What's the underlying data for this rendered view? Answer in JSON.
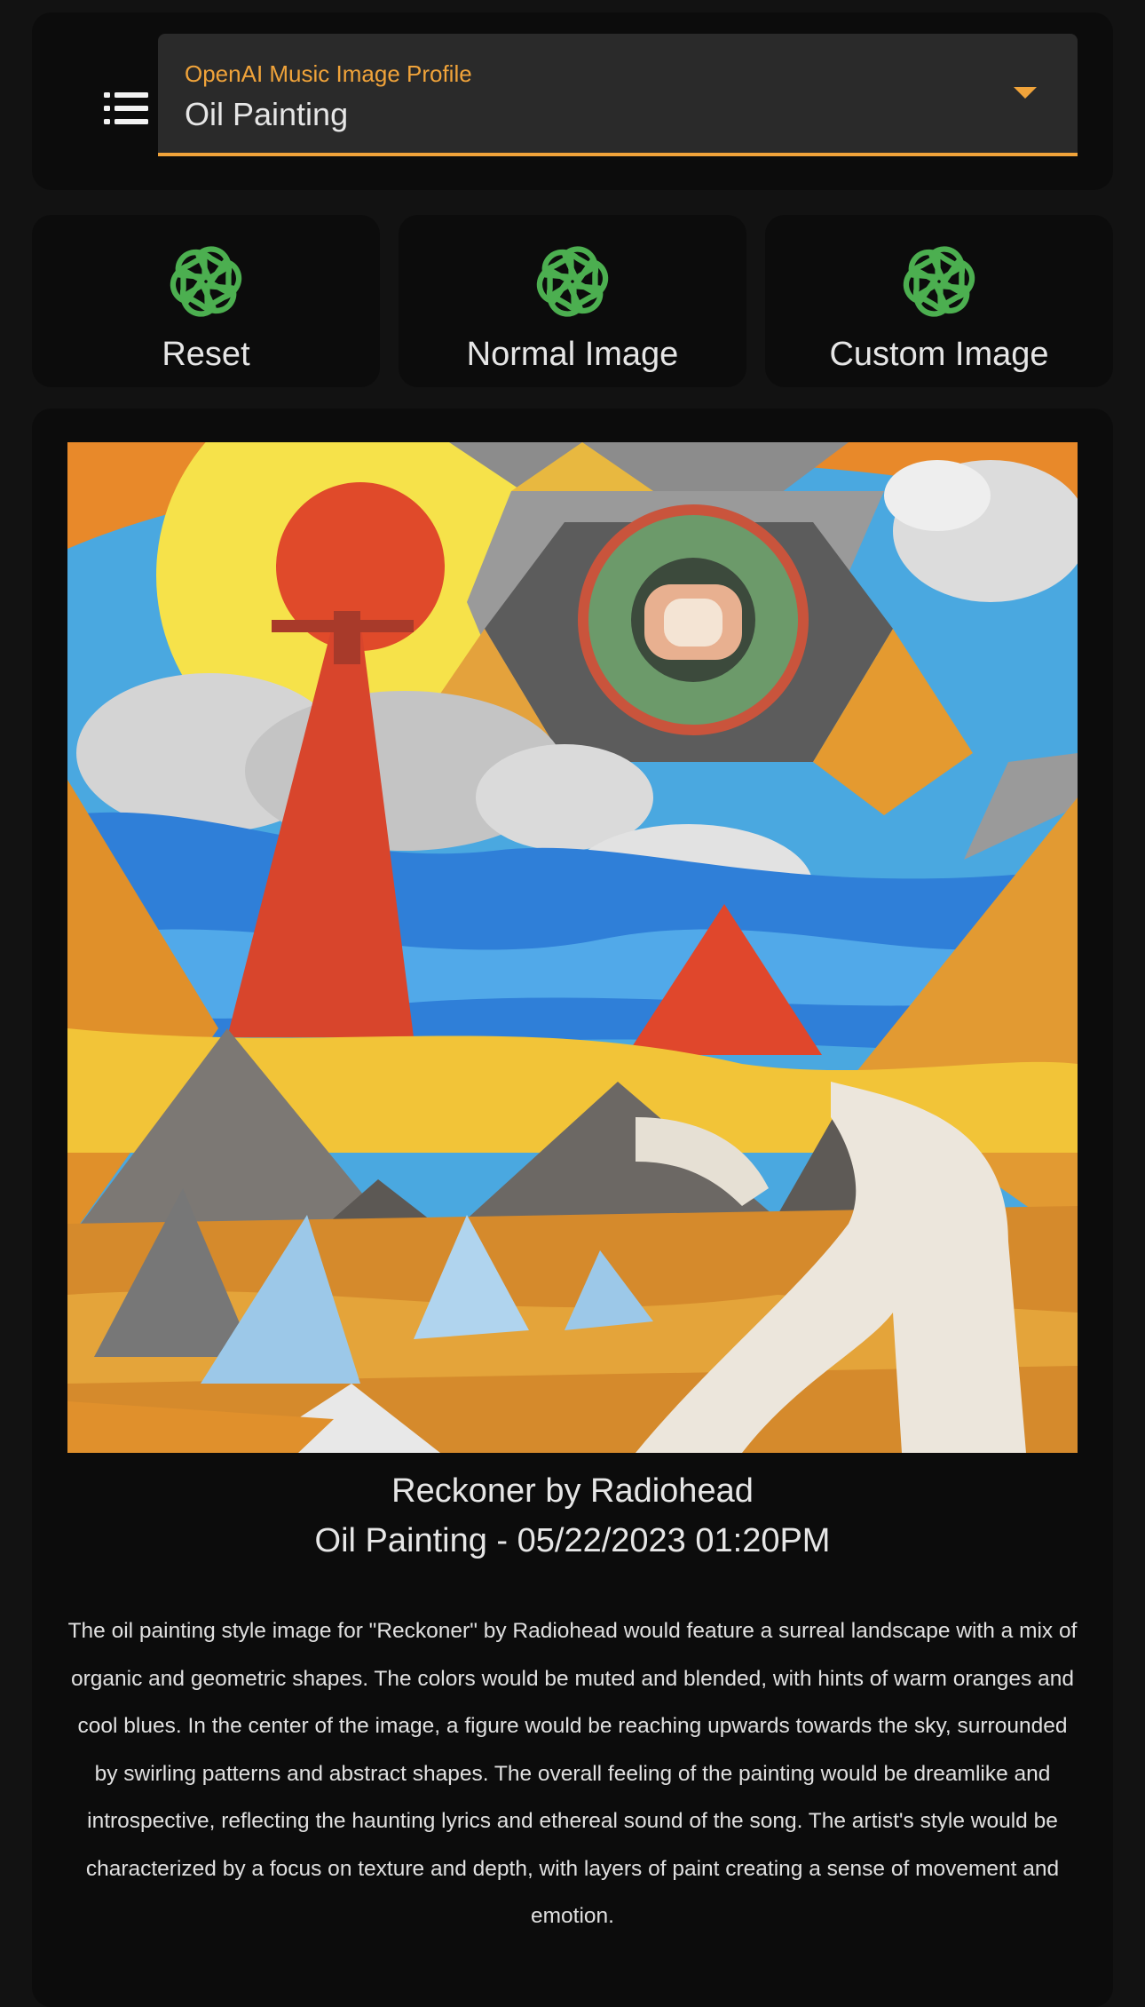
{
  "profile": {
    "label": "OpenAI Music Image Profile",
    "value": "Oil Painting"
  },
  "actions": {
    "reset_label": "Reset",
    "normal_label": "Normal Image",
    "custom_label": "Custom Image"
  },
  "artwork": {
    "title": "Reckoner by Radiohead",
    "subtitle": "Oil Painting - 05/22/2023 01:20PM",
    "description": "The oil painting style image for \"Reckoner\" by Radiohead would feature a surreal landscape with a mix of organic and geometric shapes. The colors would be muted and blended, with hints of warm oranges and cool blues. In the center of the image, a figure would be reaching upwards towards the sky, surrounded by swirling patterns and abstract shapes. The overall feeling of the painting would be dreamlike and introspective, reflecting the haunting lyrics and ethereal sound of the song. The artist's style would be characterized by a focus on texture and depth, with layers of paint creating a sense of movement and emotion."
  },
  "icons": {
    "menu": "list-menu-icon",
    "openai": "openai-logo-icon",
    "dropdown": "caret-down-icon"
  },
  "colors": {
    "accent": "#f0a33a",
    "icon_green": "#4caf50",
    "background": "#121212",
    "card": "#0c0c0c",
    "field": "#2a2a2a"
  }
}
